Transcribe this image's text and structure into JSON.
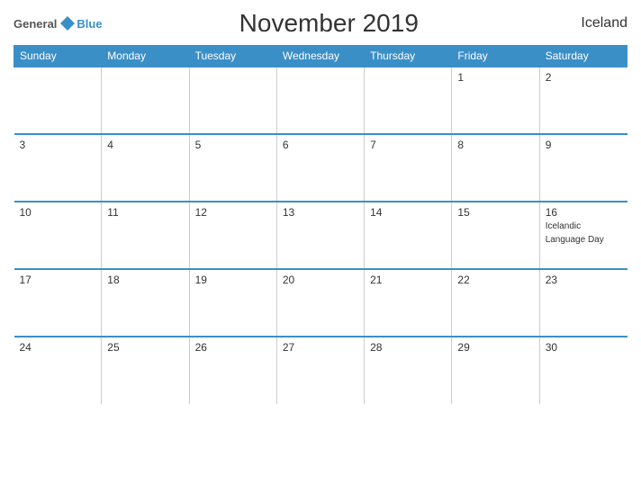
{
  "header": {
    "logo_general": "General",
    "logo_blue": "Blue",
    "title": "November 2019",
    "country": "Iceland"
  },
  "calendar": {
    "weekdays": [
      "Sunday",
      "Monday",
      "Tuesday",
      "Wednesday",
      "Thursday",
      "Friday",
      "Saturday"
    ],
    "weeks": [
      [
        {
          "day": "",
          "event": ""
        },
        {
          "day": "",
          "event": ""
        },
        {
          "day": "",
          "event": ""
        },
        {
          "day": "",
          "event": ""
        },
        {
          "day": "",
          "event": ""
        },
        {
          "day": "1",
          "event": ""
        },
        {
          "day": "2",
          "event": ""
        }
      ],
      [
        {
          "day": "3",
          "event": ""
        },
        {
          "day": "4",
          "event": ""
        },
        {
          "day": "5",
          "event": ""
        },
        {
          "day": "6",
          "event": ""
        },
        {
          "day": "7",
          "event": ""
        },
        {
          "day": "8",
          "event": ""
        },
        {
          "day": "9",
          "event": ""
        }
      ],
      [
        {
          "day": "10",
          "event": ""
        },
        {
          "day": "11",
          "event": ""
        },
        {
          "day": "12",
          "event": ""
        },
        {
          "day": "13",
          "event": ""
        },
        {
          "day": "14",
          "event": ""
        },
        {
          "day": "15",
          "event": ""
        },
        {
          "day": "16",
          "event": "Icelandic Language Day"
        }
      ],
      [
        {
          "day": "17",
          "event": ""
        },
        {
          "day": "18",
          "event": ""
        },
        {
          "day": "19",
          "event": ""
        },
        {
          "day": "20",
          "event": ""
        },
        {
          "day": "21",
          "event": ""
        },
        {
          "day": "22",
          "event": ""
        },
        {
          "day": "23",
          "event": ""
        }
      ],
      [
        {
          "day": "24",
          "event": ""
        },
        {
          "day": "25",
          "event": ""
        },
        {
          "day": "26",
          "event": ""
        },
        {
          "day": "27",
          "event": ""
        },
        {
          "day": "28",
          "event": ""
        },
        {
          "day": "29",
          "event": ""
        },
        {
          "day": "30",
          "event": ""
        }
      ]
    ]
  }
}
